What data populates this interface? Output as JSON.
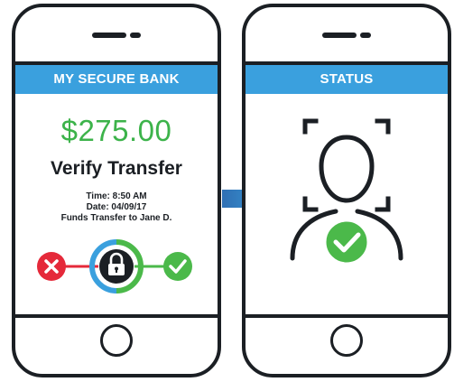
{
  "left_phone": {
    "header": "MY SECURE BANK",
    "amount": "$275.00",
    "title": "Verify Transfer",
    "time": "Time: 8:50 AM",
    "date": "Date: 04/09/17",
    "funds": "Funds Transfer to Jane D."
  },
  "right_phone": {
    "header": "STATUS"
  },
  "colors": {
    "header_blue": "#3aa0de",
    "amount_green": "#3cb34a",
    "reject_red": "#e5293a",
    "approve_green": "#4bb94a",
    "outline": "#1b1f24"
  },
  "icons": [
    "close-icon",
    "lock-icon",
    "check-icon",
    "arrow-right-icon",
    "face-id-icon",
    "home-button"
  ]
}
